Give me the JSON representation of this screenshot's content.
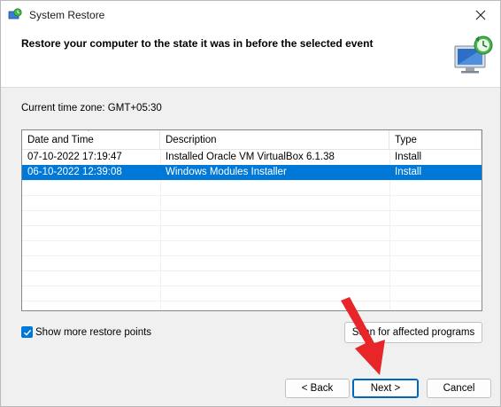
{
  "window": {
    "title": "System Restore",
    "close_symbol": "✕"
  },
  "header": {
    "title": "Restore your computer to the state it was in before the selected event"
  },
  "timezone": {
    "label": "Current time zone: GMT+05:30"
  },
  "table": {
    "columns": [
      "Date and Time",
      "Description",
      "Type"
    ],
    "rows": [
      {
        "date": "07-10-2022 17:19:47",
        "description": "Installed Oracle VM VirtualBox 6.1.38",
        "type": "Install",
        "selected": false
      },
      {
        "date": "06-10-2022 12:39:08",
        "description": "Windows Modules Installer",
        "type": "Install",
        "selected": true
      }
    ]
  },
  "options": {
    "show_more_label": "Show more restore points",
    "show_more_checked": true,
    "scan_label": "Scan for affected programs"
  },
  "footer": {
    "back_label": "< Back",
    "next_label": "Next >",
    "cancel_label": "Cancel"
  },
  "colors": {
    "accent": "#0078d7",
    "annotation_arrow": "#e8262a"
  }
}
